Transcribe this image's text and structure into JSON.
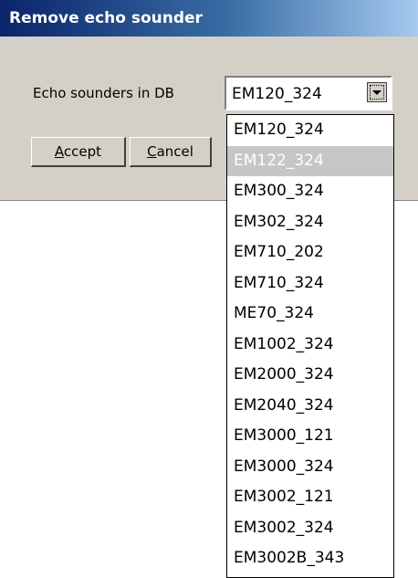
{
  "window": {
    "title": "Remove echo sounder"
  },
  "form": {
    "label": "Echo sounders in DB",
    "selected_value": "EM120_324"
  },
  "buttons": {
    "accept": {
      "mnemonic": "A",
      "rest": "ccept"
    },
    "cancel": {
      "mnemonic": "C",
      "rest": "ancel"
    }
  },
  "dropdown": {
    "highlighted_index": 1,
    "options": [
      "EM120_324",
      "EM122_324",
      "EM300_324",
      "EM302_324",
      "EM710_202",
      "EM710_324",
      "ME70_324",
      "EM1002_324",
      "EM2000_324",
      "EM2040_324",
      "EM3000_121",
      "EM3000_324",
      "EM3002_121",
      "EM3002_324",
      "EM3002B_343"
    ]
  },
  "icons": {
    "dropdown_arrow": "chevron-down-icon"
  },
  "colors": {
    "dialog_bg": "#d4d0c8",
    "title_gradient_start": "#0a246a",
    "title_gradient_end": "#a6caf0",
    "highlight_bg": "#c6c6c6"
  }
}
